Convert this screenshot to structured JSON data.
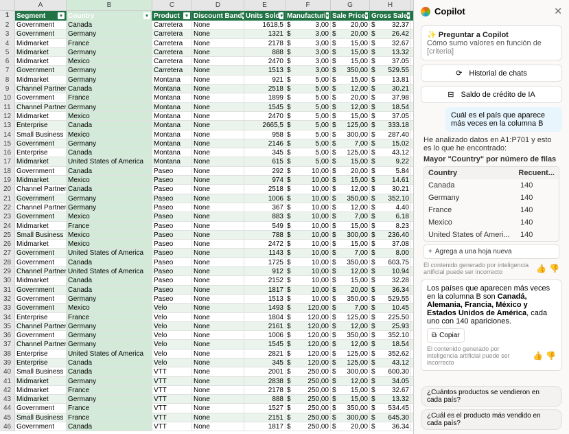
{
  "columns_letters": [
    "A",
    "B",
    "C",
    "D",
    "E",
    "F",
    "G",
    "H"
  ],
  "headers": [
    "Segment",
    "Country",
    "Product",
    "Discount Band",
    "Units Sold",
    "Manufacturi",
    "Sale Price",
    "Gross Sale"
  ],
  "rows": [
    {
      "n": 2,
      "seg": "Government",
      "ctry": "Canada",
      "prod": "Carretera",
      "disc": "None",
      "units": "1618,5",
      "man": "3,00",
      "sale": "20,00",
      "gross": "32.37"
    },
    {
      "n": 3,
      "seg": "Government",
      "ctry": "Germany",
      "prod": "Carretera",
      "disc": "None",
      "units": "1321",
      "man": "3,00",
      "sale": "20,00",
      "gross": "26.42"
    },
    {
      "n": 4,
      "seg": "Midmarket",
      "ctry": "France",
      "prod": "Carretera",
      "disc": "None",
      "units": "2178",
      "man": "3,00",
      "sale": "15,00",
      "gross": "32.67"
    },
    {
      "n": 5,
      "seg": "Midmarket",
      "ctry": "Germany",
      "prod": "Carretera",
      "disc": "None",
      "units": "888",
      "man": "3,00",
      "sale": "15,00",
      "gross": "13.32"
    },
    {
      "n": 6,
      "seg": "Midmarket",
      "ctry": "Mexico",
      "prod": "Carretera",
      "disc": "None",
      "units": "2470",
      "man": "3,00",
      "sale": "15,00",
      "gross": "37.05"
    },
    {
      "n": 7,
      "seg": "Government",
      "ctry": "Germany",
      "prod": "Carretera",
      "disc": "None",
      "units": "1513",
      "man": "3,00",
      "sale": "350,00",
      "gross": "529.55"
    },
    {
      "n": 8,
      "seg": "Midmarket",
      "ctry": "Germany",
      "prod": "Montana",
      "disc": "None",
      "units": "921",
      "man": "5,00",
      "sale": "15,00",
      "gross": "13.81"
    },
    {
      "n": 9,
      "seg": "Channel Partners",
      "ctry": "Canada",
      "prod": "Montana",
      "disc": "None",
      "units": "2518",
      "man": "5,00",
      "sale": "12,00",
      "gross": "30.21"
    },
    {
      "n": 10,
      "seg": "Government",
      "ctry": "France",
      "prod": "Montana",
      "disc": "None",
      "units": "1899",
      "man": "5,00",
      "sale": "20,00",
      "gross": "37.98"
    },
    {
      "n": 11,
      "seg": "Channel Partners",
      "ctry": "Germany",
      "prod": "Montana",
      "disc": "None",
      "units": "1545",
      "man": "5,00",
      "sale": "12,00",
      "gross": "18.54"
    },
    {
      "n": 12,
      "seg": "Midmarket",
      "ctry": "Mexico",
      "prod": "Montana",
      "disc": "None",
      "units": "2470",
      "man": "5,00",
      "sale": "15,00",
      "gross": "37.05"
    },
    {
      "n": 13,
      "seg": "Enterprise",
      "ctry": "Canada",
      "prod": "Montana",
      "disc": "None",
      "units": "2665,5",
      "man": "5,00",
      "sale": "125,00",
      "gross": "333.18"
    },
    {
      "n": 14,
      "seg": "Small Business",
      "ctry": "Mexico",
      "prod": "Montana",
      "disc": "None",
      "units": "958",
      "man": "5,00",
      "sale": "300,00",
      "gross": "287.40"
    },
    {
      "n": 15,
      "seg": "Government",
      "ctry": "Germany",
      "prod": "Montana",
      "disc": "None",
      "units": "2146",
      "man": "5,00",
      "sale": "7,00",
      "gross": "15.02"
    },
    {
      "n": 16,
      "seg": "Enterprise",
      "ctry": "Canada",
      "prod": "Montana",
      "disc": "None",
      "units": "345",
      "man": "5,00",
      "sale": "125,00",
      "gross": "43.12"
    },
    {
      "n": 17,
      "seg": "Midmarket",
      "ctry": "United States of America",
      "prod": "Montana",
      "disc": "None",
      "units": "615",
      "man": "5,00",
      "sale": "15,00",
      "gross": "9.22"
    },
    {
      "n": 18,
      "seg": "Government",
      "ctry": "Canada",
      "prod": "Paseo",
      "disc": "None",
      "units": "292",
      "man": "10,00",
      "sale": "20,00",
      "gross": "5.84"
    },
    {
      "n": 19,
      "seg": "Midmarket",
      "ctry": "Mexico",
      "prod": "Paseo",
      "disc": "None",
      "units": "974",
      "man": "10,00",
      "sale": "15,00",
      "gross": "14.61"
    },
    {
      "n": 20,
      "seg": "Channel Partners",
      "ctry": "Canada",
      "prod": "Paseo",
      "disc": "None",
      "units": "2518",
      "man": "10,00",
      "sale": "12,00",
      "gross": "30.21"
    },
    {
      "n": 21,
      "seg": "Government",
      "ctry": "Germany",
      "prod": "Paseo",
      "disc": "None",
      "units": "1006",
      "man": "10,00",
      "sale": "350,00",
      "gross": "352.10"
    },
    {
      "n": 22,
      "seg": "Channel Partners",
      "ctry": "Germany",
      "prod": "Paseo",
      "disc": "None",
      "units": "367",
      "man": "10,00",
      "sale": "12,00",
      "gross": "4.40"
    },
    {
      "n": 23,
      "seg": "Government",
      "ctry": "Mexico",
      "prod": "Paseo",
      "disc": "None",
      "units": "883",
      "man": "10,00",
      "sale": "7,00",
      "gross": "6.18"
    },
    {
      "n": 24,
      "seg": "Midmarket",
      "ctry": "France",
      "prod": "Paseo",
      "disc": "None",
      "units": "549",
      "man": "10,00",
      "sale": "15,00",
      "gross": "8.23"
    },
    {
      "n": 25,
      "seg": "Small Business",
      "ctry": "Mexico",
      "prod": "Paseo",
      "disc": "None",
      "units": "788",
      "man": "10,00",
      "sale": "300,00",
      "gross": "236.40"
    },
    {
      "n": 26,
      "seg": "Midmarket",
      "ctry": "Mexico",
      "prod": "Paseo",
      "disc": "None",
      "units": "2472",
      "man": "10,00",
      "sale": "15,00",
      "gross": "37.08"
    },
    {
      "n": 27,
      "seg": "Government",
      "ctry": "United States of America",
      "prod": "Paseo",
      "disc": "None",
      "units": "1143",
      "man": "10,00",
      "sale": "7,00",
      "gross": "8.00"
    },
    {
      "n": 28,
      "seg": "Government",
      "ctry": "Canada",
      "prod": "Paseo",
      "disc": "None",
      "units": "1725",
      "man": "10,00",
      "sale": "350,00",
      "gross": "603.75"
    },
    {
      "n": 29,
      "seg": "Channel Partners",
      "ctry": "United States of America",
      "prod": "Paseo",
      "disc": "None",
      "units": "912",
      "man": "10,00",
      "sale": "12,00",
      "gross": "10.94"
    },
    {
      "n": 30,
      "seg": "Midmarket",
      "ctry": "Canada",
      "prod": "Paseo",
      "disc": "None",
      "units": "2152",
      "man": "10,00",
      "sale": "15,00",
      "gross": "32.28"
    },
    {
      "n": 31,
      "seg": "Government",
      "ctry": "Canada",
      "prod": "Paseo",
      "disc": "None",
      "units": "1817",
      "man": "10,00",
      "sale": "20,00",
      "gross": "36.34"
    },
    {
      "n": 32,
      "seg": "Government",
      "ctry": "Germany",
      "prod": "Paseo",
      "disc": "None",
      "units": "1513",
      "man": "10,00",
      "sale": "350,00",
      "gross": "529.55"
    },
    {
      "n": 33,
      "seg": "Government",
      "ctry": "Mexico",
      "prod": "Velo",
      "disc": "None",
      "units": "1493",
      "man": "120,00",
      "sale": "7,00",
      "gross": "10.45"
    },
    {
      "n": 34,
      "seg": "Enterprise",
      "ctry": "France",
      "prod": "Velo",
      "disc": "None",
      "units": "1804",
      "man": "120,00",
      "sale": "125,00",
      "gross": "225.50"
    },
    {
      "n": 35,
      "seg": "Channel Partners",
      "ctry": "Germany",
      "prod": "Velo",
      "disc": "None",
      "units": "2161",
      "man": "120,00",
      "sale": "12,00",
      "gross": "25.93"
    },
    {
      "n": 36,
      "seg": "Government",
      "ctry": "Germany",
      "prod": "Velo",
      "disc": "None",
      "units": "1006",
      "man": "120,00",
      "sale": "350,00",
      "gross": "352.10"
    },
    {
      "n": 37,
      "seg": "Channel Partners",
      "ctry": "Germany",
      "prod": "Velo",
      "disc": "None",
      "units": "1545",
      "man": "120,00",
      "sale": "12,00",
      "gross": "18.54"
    },
    {
      "n": 38,
      "seg": "Enterprise",
      "ctry": "United States of America",
      "prod": "Velo",
      "disc": "None",
      "units": "2821",
      "man": "120,00",
      "sale": "125,00",
      "gross": "352.62"
    },
    {
      "n": 39,
      "seg": "Enterprise",
      "ctry": "Canada",
      "prod": "Velo",
      "disc": "None",
      "units": "345",
      "man": "120,00",
      "sale": "125,00",
      "gross": "43.12"
    },
    {
      "n": 40,
      "seg": "Small Business",
      "ctry": "Canada",
      "prod": "VTT",
      "disc": "None",
      "units": "2001",
      "man": "250,00",
      "sale": "300,00",
      "gross": "600.30"
    },
    {
      "n": 41,
      "seg": "Midmarket",
      "ctry": "Germany",
      "prod": "VTT",
      "disc": "None",
      "units": "2838",
      "man": "250,00",
      "sale": "12,00",
      "gross": "34.05"
    },
    {
      "n": 42,
      "seg": "Midmarket",
      "ctry": "France",
      "prod": "VTT",
      "disc": "None",
      "units": "2178",
      "man": "250,00",
      "sale": "15,00",
      "gross": "32.67"
    },
    {
      "n": 43,
      "seg": "Midmarket",
      "ctry": "Germany",
      "prod": "VTT",
      "disc": "None",
      "units": "888",
      "man": "250,00",
      "sale": "15,00",
      "gross": "13.32"
    },
    {
      "n": 44,
      "seg": "Government",
      "ctry": "France",
      "prod": "VTT",
      "disc": "None",
      "units": "1527",
      "man": "250,00",
      "sale": "350,00",
      "gross": "534.45"
    },
    {
      "n": 45,
      "seg": "Small Business",
      "ctry": "France",
      "prod": "VTT",
      "disc": "None",
      "units": "2151",
      "man": "250,00",
      "sale": "300,00",
      "gross": "645.30"
    },
    {
      "n": 46,
      "seg": "Government",
      "ctry": "Canada",
      "prod": "VTT",
      "disc": "None",
      "units": "1817",
      "man": "250,00",
      "sale": "20,00",
      "gross": "36.34"
    }
  ],
  "copilot": {
    "title": "Copilot",
    "suggest_title": "Preguntar a Copilot",
    "suggest_text_pre": "Cómo sumo valores en función de ",
    "suggest_text_em": "[criteria]",
    "history_btn": "Historial de chats",
    "credit_btn": "Saldo de crédito de IA",
    "user_question": "Cuál es el país que aparece más veces en la columna B",
    "resp_intro": "He analizado datos en A1:P701 y esto es lo que he encontrado:",
    "resp_heading": "Mayor \"Country\" por número de filas",
    "table_hdr1": "Country",
    "table_hdr2": "Recuent...",
    "table_rows": [
      {
        "c": "Canada",
        "n": "140"
      },
      {
        "c": "Germany",
        "n": "140"
      },
      {
        "c": "France",
        "n": "140"
      },
      {
        "c": "Mexico",
        "n": "140"
      },
      {
        "c": "United States of Ameri...",
        "n": "140"
      }
    ],
    "add_sheet": "Agrega a una hoja nueva",
    "disclaimer": "El contenido generado por inteligencia artificial puede ser incorrecto",
    "summary_pre": "Los países que aparecen más veces en la columna B son ",
    "summary_bold": "Canadá, Alemania, Francia, México y Estados Unidos de América",
    "summary_post": ", cada uno con 140 apariciones.",
    "copy_btn": "Copiar",
    "chip1": "¿Cuántos productos se vendieron en cada país?",
    "chip2": "¿Cuál es el producto más vendido en cada país?"
  }
}
